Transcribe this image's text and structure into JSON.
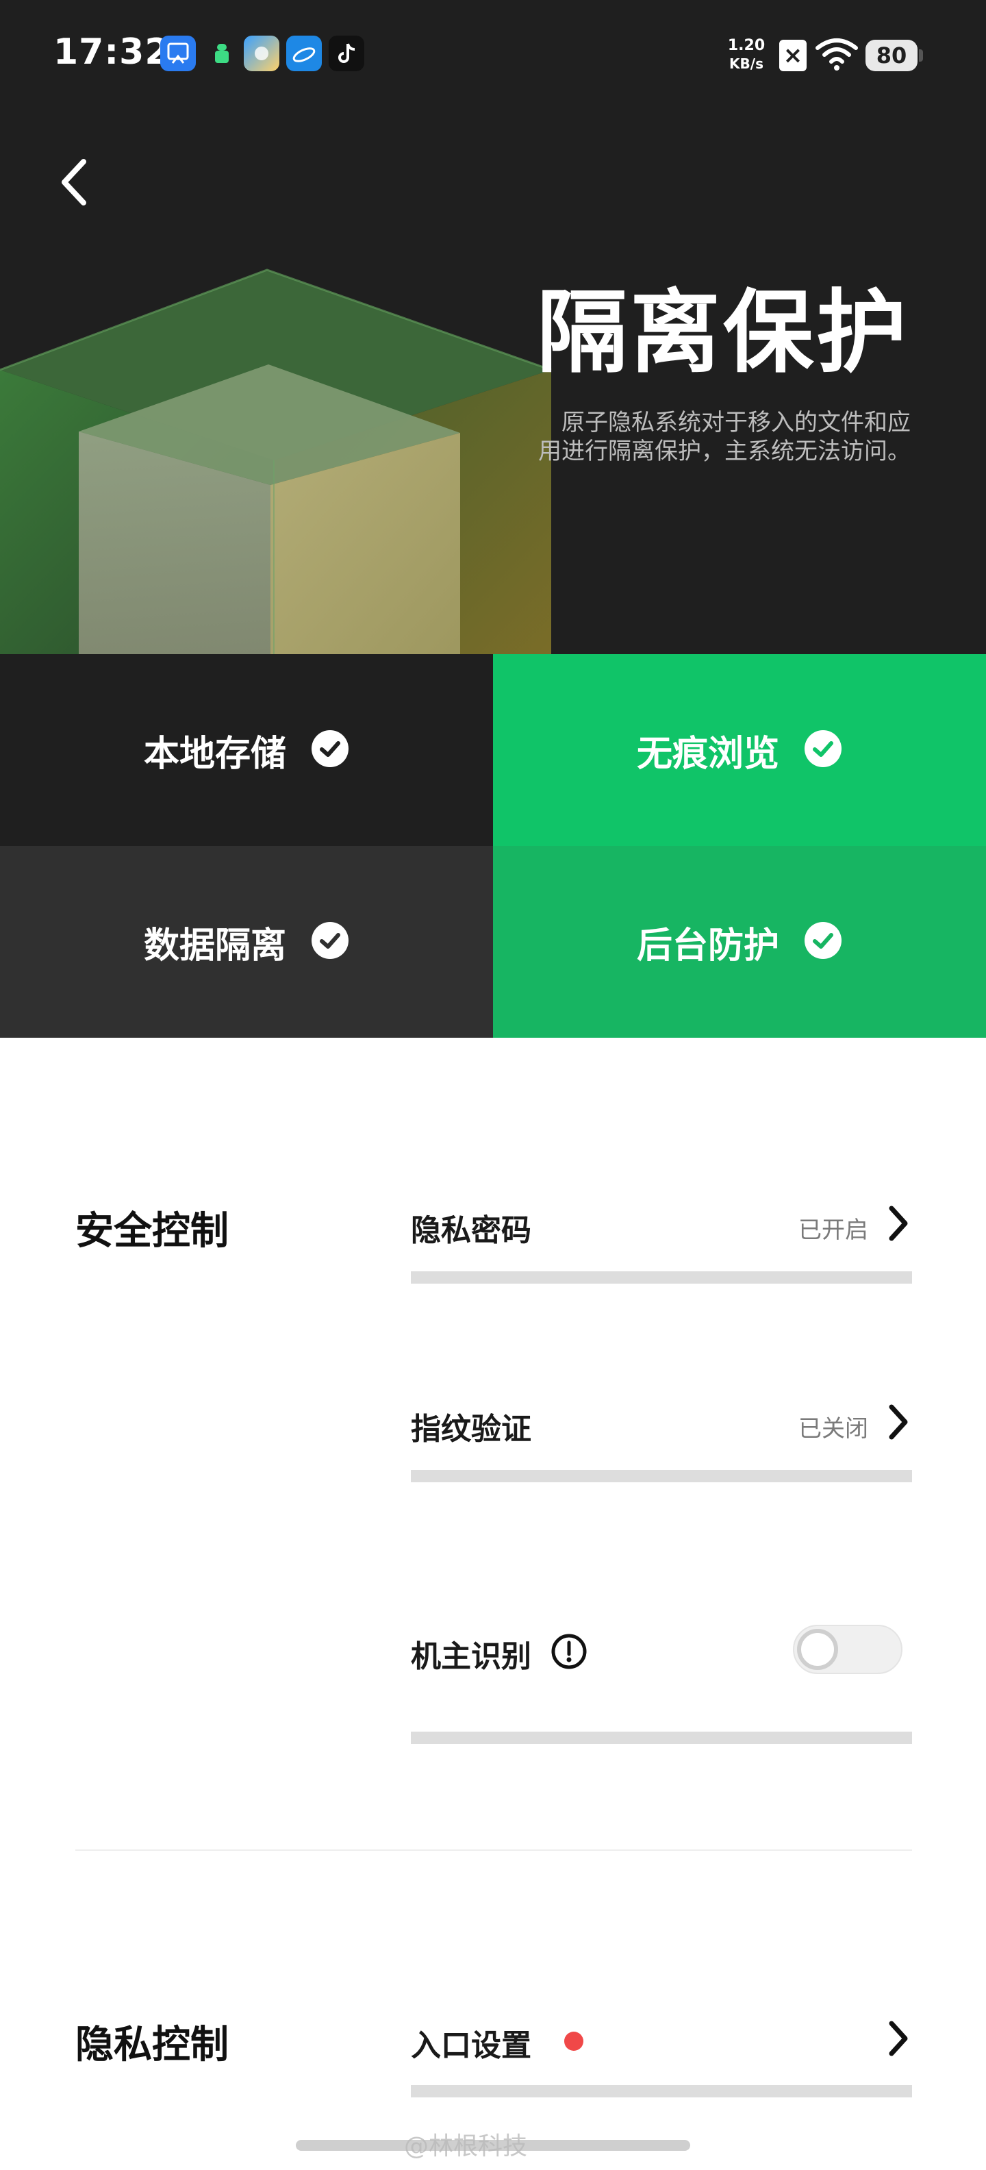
{
  "status_bar": {
    "time": "17:32",
    "net_speed_value": "1.20",
    "net_speed_unit": "KB/s",
    "battery": "80",
    "icons": [
      "screen-mirror-app-icon",
      "android-app-icon",
      "photos-app-icon",
      "browser-app-icon",
      "tiktok-app-icon",
      "no-sim-icon",
      "wifi-icon",
      "battery-icon"
    ]
  },
  "hero": {
    "title": "隔离保护",
    "description_line1": "原子隐私系统对于移入的文件和应",
    "description_line2": "用进行隔离保护，主系统无法访问。"
  },
  "features": [
    {
      "label": "本地存储",
      "bg": "#1f1f1f"
    },
    {
      "label": "无痕浏览",
      "bg": "#10c468"
    },
    {
      "label": "数据隔离",
      "bg": "#303030"
    },
    {
      "label": "后台防护",
      "bg": "#17b562"
    }
  ],
  "security_control": {
    "title": "安全控制",
    "items": [
      {
        "label": "隐私密码",
        "status": "已开启"
      },
      {
        "label": "指纹验证",
        "status": "已关闭"
      },
      {
        "label": "机主识别",
        "toggle_on": false
      }
    ]
  },
  "privacy_control": {
    "title": "隐私控制",
    "items": [
      {
        "label": "入口设置",
        "has_badge": true
      }
    ]
  },
  "watermark": "@林根科技",
  "colors": {
    "hero_bg": "#1f1f1f",
    "accent_green": "#10c468",
    "badge_red": "#f04848"
  }
}
